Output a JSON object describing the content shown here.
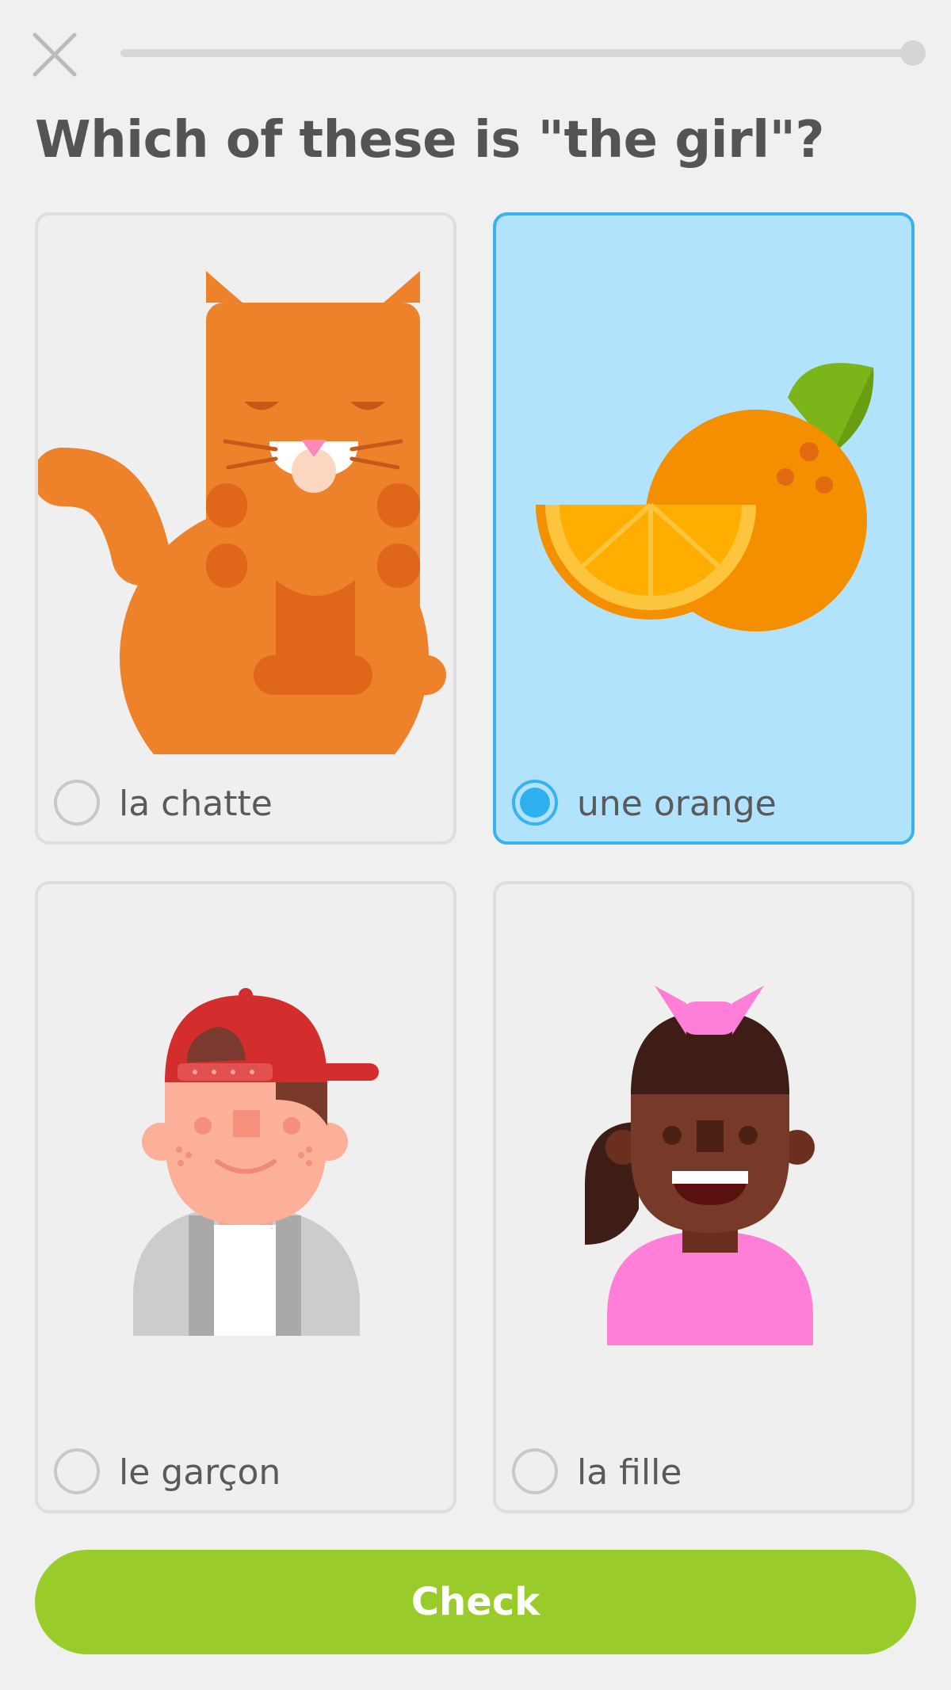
{
  "header": {
    "close_icon": "close-x-icon",
    "progress_fraction": 1.0
  },
  "question": {
    "text": "Which of these is \"the girl\"?"
  },
  "options": [
    {
      "label": "la chatte",
      "image": "cat-illustration",
      "selected": false
    },
    {
      "label": "une orange",
      "image": "orange-illustration",
      "selected": true
    },
    {
      "label": "le garçon",
      "image": "boy-illustration",
      "selected": false
    },
    {
      "label": "la fille",
      "image": "girl-illustration",
      "selected": false
    }
  ],
  "footer": {
    "check_label": "Check"
  },
  "colors": {
    "background": "#f0f0f0",
    "selected_bg": "#b2e3fd",
    "selected_border": "#39b2ee",
    "check_button": "#99cc2a",
    "card_border": "#dedede"
  }
}
